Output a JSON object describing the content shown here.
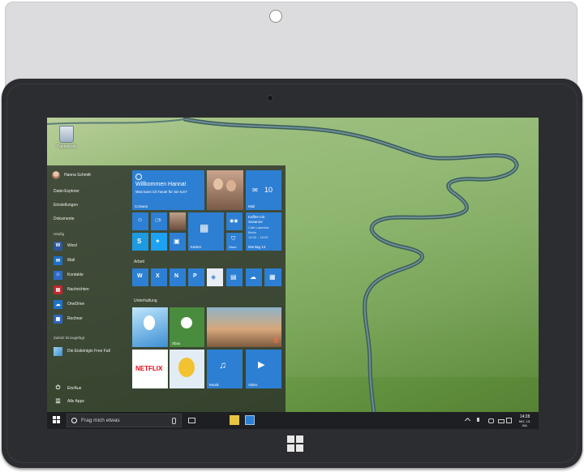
{
  "desktop": {
    "recycle_bin_label": "Papierkorb"
  },
  "start_menu": {
    "user_name": "Hanna Schmitt",
    "links": [
      "Datei-Explorer",
      "Einstellungen",
      "Dokumente"
    ],
    "frequent_header": "Häufig",
    "frequent_apps": [
      {
        "label": "Word",
        "icon": "word-icon",
        "color": "#2b579a"
      },
      {
        "label": "Mail",
        "icon": "mail-icon",
        "color": "#1f6fc5"
      },
      {
        "label": "Kontakte",
        "icon": "contacts-icon",
        "color": "#2d6bc8"
      },
      {
        "label": "Nachrichten",
        "icon": "news-icon",
        "color": "#c1272d"
      },
      {
        "label": "OneDrive",
        "icon": "onedrive-icon",
        "color": "#1f72c6"
      },
      {
        "label": "Rechner",
        "icon": "calculator-icon",
        "color": "#2e66be"
      }
    ],
    "recent_header": "Zuletzt hinzugefügt",
    "recent_app": {
      "label": "Die Eiskönigin Free Fall",
      "icon": "frozen-app-icon"
    },
    "power_label": "Ein/Aus",
    "all_apps_label": "Alle Apps",
    "tiles": {
      "cortana": {
        "title": "Willkommen Hanna!",
        "subtitle": "Was kann ich heute für Sie tun?",
        "label": "Cortana"
      },
      "mail": {
        "count": "10",
        "label": "Mail"
      },
      "calendar": {
        "text": [
          "Kaffee mit",
          "Susanne",
          "Café Lakeside",
          "Berlin",
          "14:00 – 15:00"
        ],
        "label": "Montag 13"
      },
      "maps_label": "Karten",
      "store_label": "Store",
      "work_header": "Arbeit",
      "entertainment_header": "Unterhaltung",
      "xbox_label": "Xbox",
      "netflix_label": "NETFLIX",
      "music_label": "Musik",
      "video_label": "Video"
    }
  },
  "taskbar": {
    "search_placeholder": "Frag mich etwas",
    "time": "14:28",
    "date": "MO, 13. JUL"
  },
  "colors": {
    "tile_blue": "#2d7fd3",
    "xbox_green": "#4a8c3d",
    "netflix_red": "#e50914"
  }
}
